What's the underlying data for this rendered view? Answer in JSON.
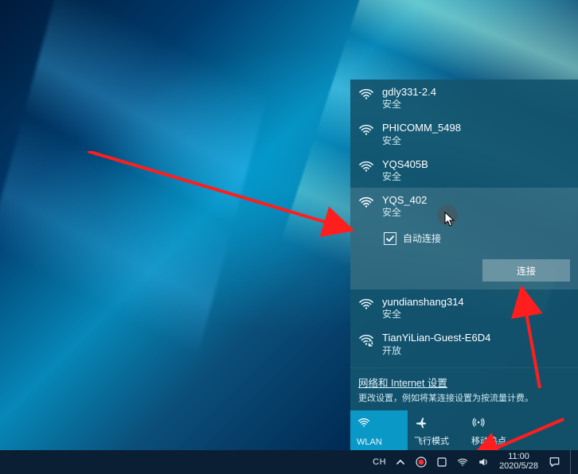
{
  "wifi": {
    "networks": [
      {
        "ssid": "gdly331-2.4",
        "security": "安全",
        "secured": true
      },
      {
        "ssid": "PHICOMM_5498",
        "security": "安全",
        "secured": true
      },
      {
        "ssid": "YQS405B",
        "security": "安全",
        "secured": true
      },
      {
        "ssid": "YQS_402",
        "security": "安全",
        "secured": true,
        "selected": true,
        "auto_connect_label": "自动连接",
        "auto_connect_checked": true,
        "connect_label": "连接"
      },
      {
        "ssid": "yundianshang314",
        "security": "安全",
        "secured": true
      },
      {
        "ssid": "TianYiLian-Guest-E6D4",
        "security": "开放",
        "secured": false
      }
    ],
    "settings_link": "网络和 Internet 设置",
    "settings_desc": "更改设置，例如将某连接设置为按流量计费。",
    "tiles": [
      {
        "label": "WLAN",
        "icon": "wifi-icon",
        "active": true
      },
      {
        "label": "飞行模式",
        "icon": "airplane-icon",
        "active": false
      },
      {
        "label": "移动热点",
        "icon": "hotspot-icon",
        "active": false
      }
    ]
  },
  "taskbar": {
    "ime": "CH",
    "time": "11:00",
    "date": "2020/5/28"
  },
  "colors": {
    "flyout_bg": "rgba(20,85,110,0.92)",
    "tile_active": "#0a98c7",
    "taskbar_bg": "#0b1f34",
    "arrow": "#ff1e1e"
  }
}
